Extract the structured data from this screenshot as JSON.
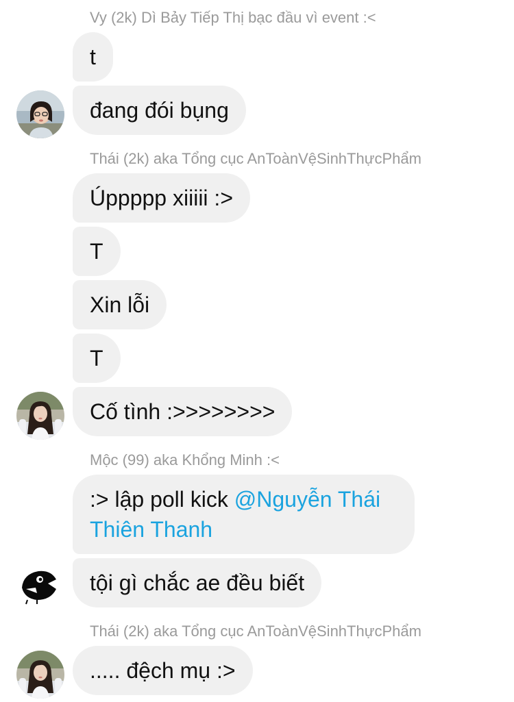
{
  "messages": {
    "group1": {
      "sender": "Vy (2k) Dì Bảy Tiếp Thị bạc đầu vì event :<",
      "bubbles": [
        "t",
        "đang đói bụng"
      ]
    },
    "group2": {
      "sender": "Thái (2k) aka Tổng cục AnToànVệSinhThựcPhẩm",
      "bubbles": [
        "Úppppp xiiiii :>",
        "T",
        "Xin lỗi",
        "T",
        "Cố tình :>>>>>>>>"
      ]
    },
    "group3": {
      "sender": "Mộc (99) aka Khổng Minh :<",
      "bubble1_prefix": ":> lập poll kick ",
      "bubble1_mention": "@Nguyễn Thái Thiên Thanh",
      "bubble2": "tội gì chắc ae đều biết"
    },
    "group4": {
      "sender": "Thái (2k) aka Tổng cục AnToànVệSinhThựcPhẩm",
      "bubbles": [
        "..... đệch mụ :>"
      ]
    }
  },
  "colors": {
    "bubble_bg": "#f0f0f0",
    "sender_text": "#9a9a9a",
    "mention": "#1aa3df",
    "message_text": "#111111"
  },
  "avatars": [
    "avatar-vy-photo",
    "avatar-thai-photo",
    "avatar-moc-bird-icon",
    "avatar-thai-photo"
  ]
}
